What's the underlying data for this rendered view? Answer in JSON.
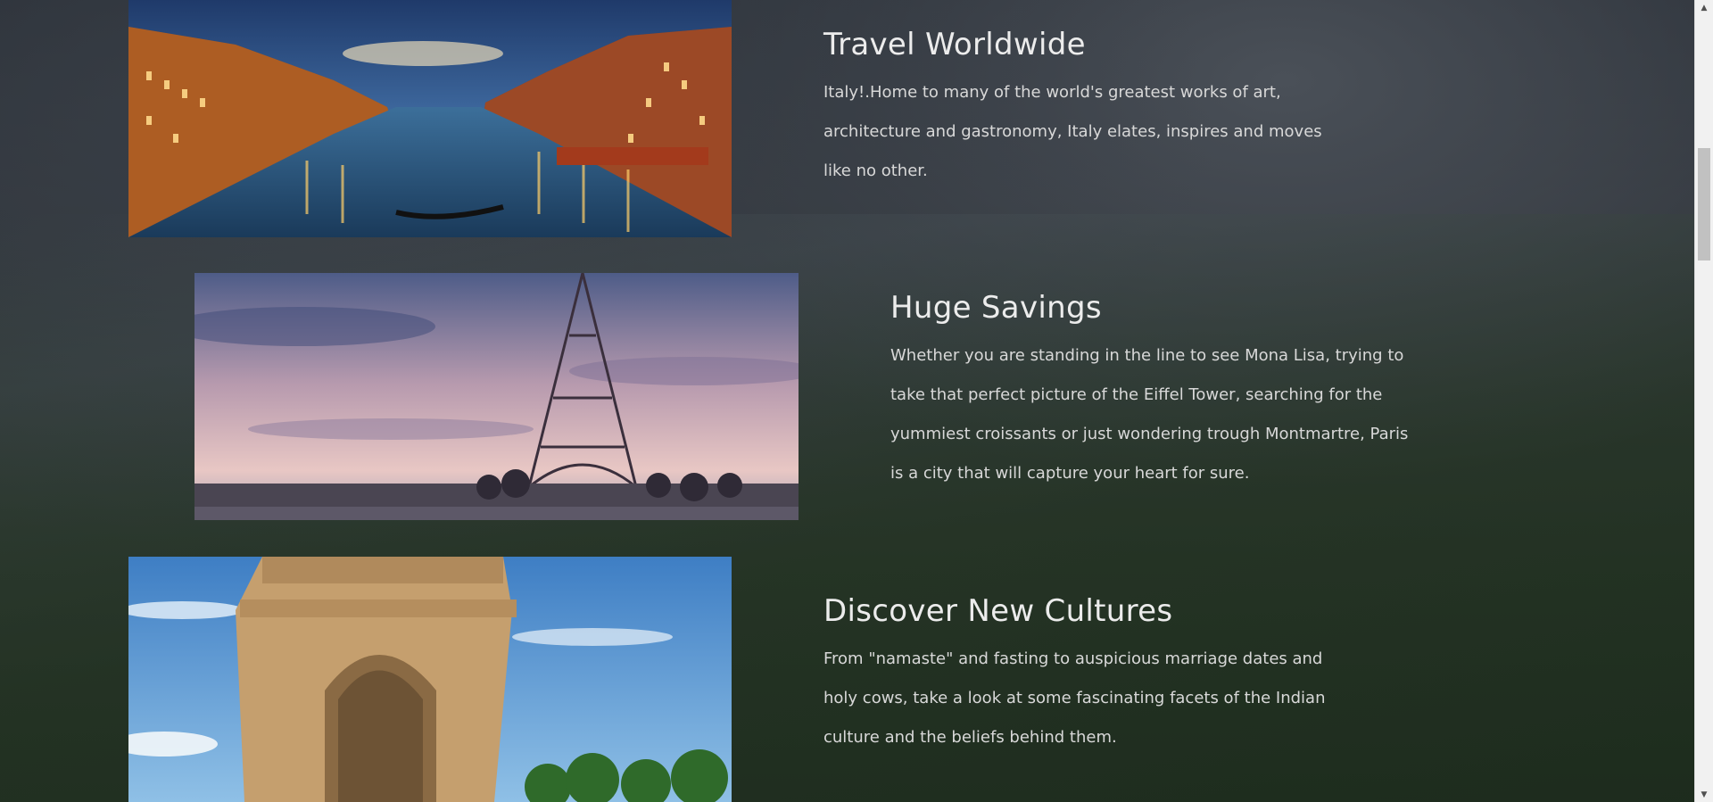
{
  "features": [
    {
      "heading": "Travel Worldwide",
      "body": "Italy!.Home to many of the world's greatest works of art, architecture and gastronomy, Italy elates, inspires and moves like no other.",
      "image_subject": "venice-canal-night"
    },
    {
      "heading": "Huge Savings",
      "body": "Whether you are standing in the line to see Mona Lisa, trying to take that perfect picture of the Eiffel Tower, searching for the yummiest croissants or just wondering trough Montmartre, Paris is a city that will capture your heart for sure.",
      "image_subject": "eiffel-tower-sunset"
    },
    {
      "heading": "Discover New Cultures",
      "body": "From \"namaste\" and fasting to auspicious marriage dates and holy cows, take a look at some fascinating facets of the Indian culture and the beliefs behind them.",
      "image_subject": "india-gate"
    }
  ],
  "scrollbar": {
    "up_icon": "triangle-up-icon",
    "down_icon": "triangle-down-icon"
  }
}
